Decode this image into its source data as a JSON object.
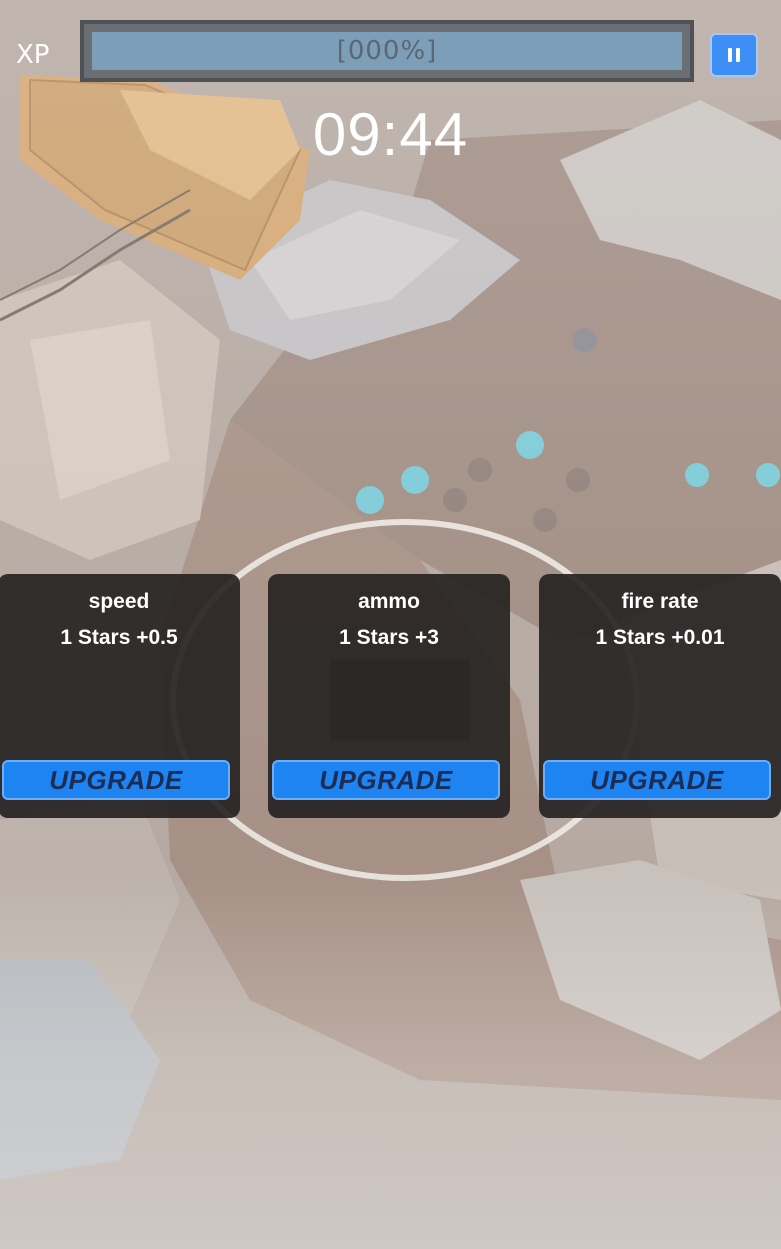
{
  "hud": {
    "xp_label": "XP",
    "xp_percent_text": "[000%]",
    "xp_progress": 0,
    "timer": "09:44",
    "pause_icon": "pause-icon"
  },
  "upgrades": [
    {
      "title": "speed",
      "effect": "1 Stars +0.5",
      "button_label": "UPGRADE"
    },
    {
      "title": "ammo",
      "effect": "1 Stars +3",
      "button_label": "UPGRADE"
    },
    {
      "title": "fire rate",
      "effect": "1 Stars +0.01",
      "button_label": "UPGRADE"
    }
  ],
  "colors": {
    "accent_blue": "#1d84f1",
    "card_bg": "#262322",
    "xp_bar_bg": "#7d9eb8"
  }
}
